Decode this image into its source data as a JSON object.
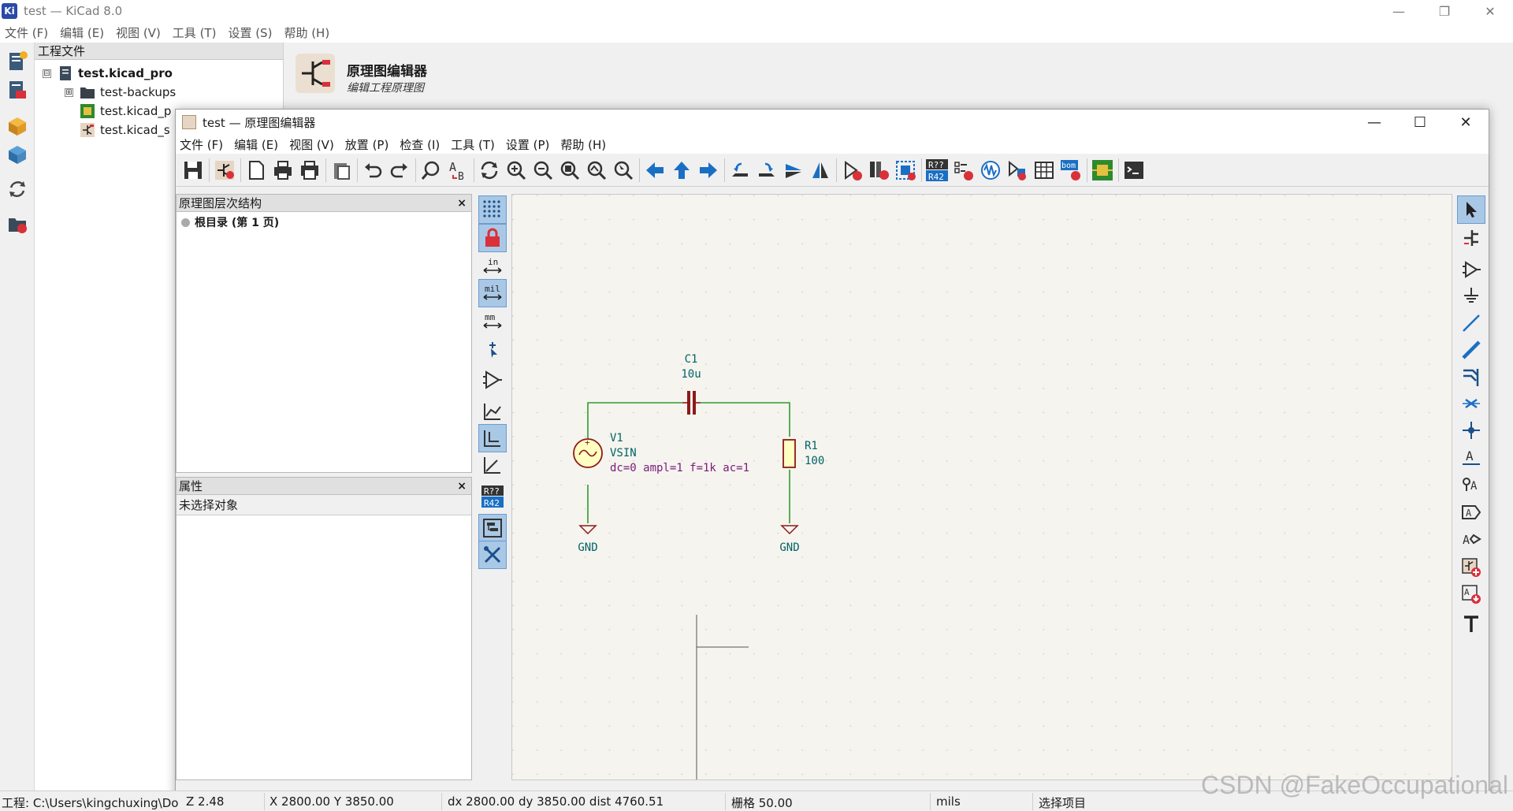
{
  "main_window": {
    "title": "test — KiCad 8.0",
    "logo": "Ki",
    "menu": [
      "文件 (F)",
      "编辑 (E)",
      "视图 (V)",
      "工具 (T)",
      "设置 (S)",
      "帮助 (H)"
    ],
    "controls": [
      "minimize-icon",
      "restore-icon",
      "close-icon"
    ]
  },
  "project_panel": {
    "header": "工程文件",
    "tree": [
      {
        "label": "test.kicad_pro",
        "bold": true,
        "expander": "⊟"
      },
      {
        "label": "test-backups",
        "expander": "⊞"
      },
      {
        "label": "test.kicad_p"
      },
      {
        "label": "test.kicad_s"
      }
    ]
  },
  "launcher": {
    "title": "原理图编辑器",
    "subtitle": "编辑工程原理图"
  },
  "schematic_window": {
    "title": "test — 原理图编辑器",
    "menu": [
      "文件 (F)",
      "编辑 (E)",
      "视图 (V)",
      "放置 (P)",
      "检查 (I)",
      "工具 (T)",
      "设置 (P)",
      "帮助 (H)"
    ],
    "controls": [
      "minimize-icon",
      "maximize-icon",
      "close-icon"
    ]
  },
  "hierarchy_panel": {
    "header": "原理图层次结构",
    "close": "×",
    "root_item": "根目录 (第 1 页)"
  },
  "properties_panel": {
    "header": "属性",
    "close": "×",
    "empty_text": "未选择对象"
  },
  "left_tools": {
    "units": {
      "in": "in",
      "mil": "mil",
      "mm": "mm"
    },
    "annotate_badge": {
      "top": "R??",
      "bottom": "R42"
    }
  },
  "toolbar": {
    "annotate_badge": {
      "top": "R??",
      "bottom": "R42"
    },
    "bom_badge": "bom"
  },
  "schematic": {
    "components": {
      "c1": {
        "ref": "C1",
        "value": "10u"
      },
      "v1": {
        "ref": "V1",
        "value": "VSIN",
        "params": "dc=0 ampl=1 f=1k ac=1",
        "symbol": "+"
      },
      "r1": {
        "ref": "R1",
        "value": "100"
      },
      "gnd_left": {
        "label": "GND"
      },
      "gnd_right": {
        "label": "GND"
      }
    },
    "colors": {
      "wire": "#2e9b2e",
      "symbol_body": "#8b1a1a",
      "symbol_fill": "#ffffc2",
      "ref_text": "#006464",
      "param_text": "#7a1a7a",
      "canvas_bg": "#f5f4ef"
    }
  },
  "statusbar": {
    "project_path": "工程: C:\\Users\\kingchuxing\\Do",
    "zoom": "Z 2.48",
    "xy": "X 2800.00  Y 3850.00",
    "delta": "dx 2800.00  dy 3850.00  dist 4760.51",
    "grid": "栅格 50.00",
    "units": "mils",
    "mode": "选择项目"
  },
  "watermark": "CSDN @FakeOccupational"
}
